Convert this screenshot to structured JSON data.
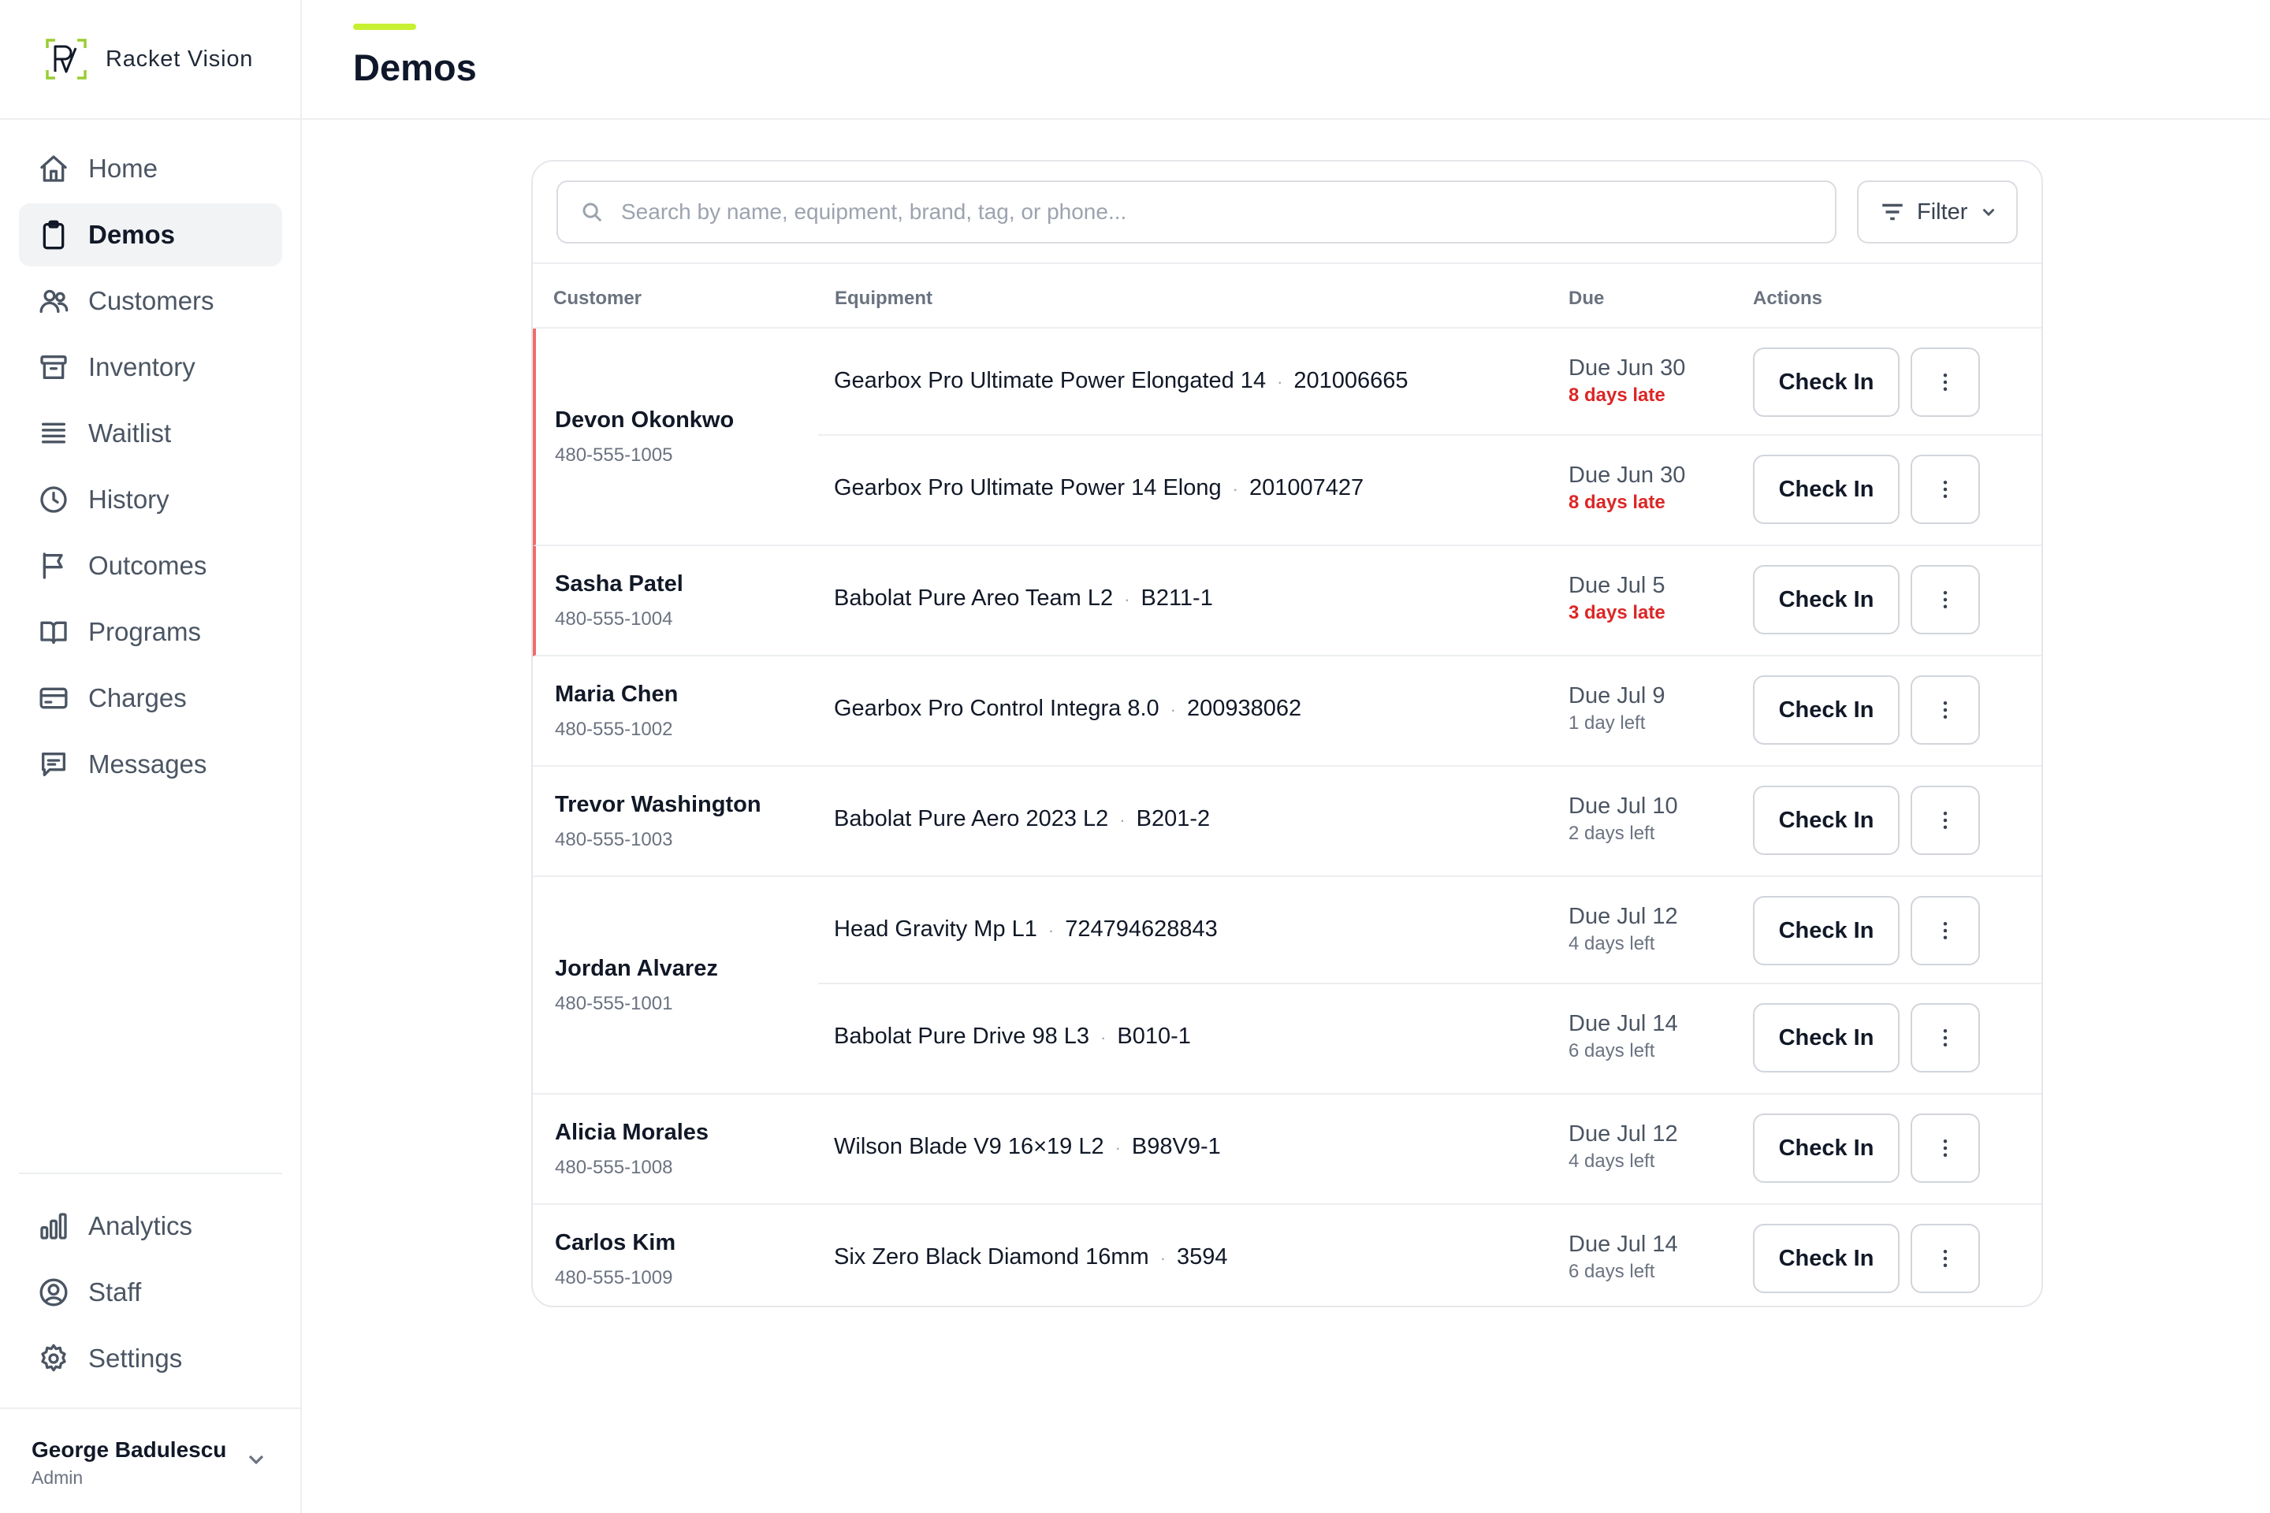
{
  "app": {
    "name": "Racket Vision"
  },
  "sidebar": {
    "items": [
      {
        "label": "Home",
        "icon": "home-icon"
      },
      {
        "label": "Demos",
        "icon": "clipboard-icon",
        "active": true
      },
      {
        "label": "Customers",
        "icon": "users-icon"
      },
      {
        "label": "Inventory",
        "icon": "archive-icon"
      },
      {
        "label": "Waitlist",
        "icon": "list-icon"
      },
      {
        "label": "History",
        "icon": "clock-icon"
      },
      {
        "label": "Outcomes",
        "icon": "flag-icon"
      },
      {
        "label": "Programs",
        "icon": "book-icon"
      },
      {
        "label": "Charges",
        "icon": "credit-card-icon"
      },
      {
        "label": "Messages",
        "icon": "message-icon"
      }
    ],
    "bottom_items": [
      {
        "label": "Analytics",
        "icon": "bar-chart-icon"
      },
      {
        "label": "Staff",
        "icon": "user-circle-icon"
      },
      {
        "label": "Settings",
        "icon": "gear-icon"
      }
    ],
    "user": {
      "name": "George Badulescu",
      "role": "Admin"
    }
  },
  "header": {
    "title": "Demos",
    "accent_color": "#c8f033"
  },
  "toolbar": {
    "search_placeholder": "Search by name, equipment, brand, tag, or phone...",
    "filter_label": "Filter"
  },
  "table": {
    "columns": {
      "customer": "Customer",
      "equipment": "Equipment",
      "due": "Due",
      "actions": "Actions"
    },
    "action_label": "Check In",
    "late_color": "#dc2626",
    "groups": [
      {
        "name": "Devon Okonkwo",
        "phone": "480-555-1005",
        "late": true,
        "items": [
          {
            "equipment": "Gearbox Pro Ultimate Power Elongated 14",
            "tag": "201006665",
            "due": "Due Jun 30",
            "status": "8 days late",
            "late": true
          },
          {
            "equipment": "Gearbox Pro Ultimate Power 14 Elong",
            "tag": "201007427",
            "due": "Due Jun 30",
            "status": "8 days late",
            "late": true
          }
        ]
      },
      {
        "name": "Sasha Patel",
        "phone": "480-555-1004",
        "late": true,
        "items": [
          {
            "equipment": "Babolat Pure Areo Team L2",
            "tag": "B211-1",
            "due": "Due Jul 5",
            "status": "3 days late",
            "late": true
          }
        ]
      },
      {
        "name": "Maria Chen",
        "phone": "480-555-1002",
        "late": false,
        "items": [
          {
            "equipment": "Gearbox Pro Control Integra 8.0",
            "tag": "200938062",
            "due": "Due Jul 9",
            "status": "1 day left",
            "late": false
          }
        ]
      },
      {
        "name": "Trevor Washington",
        "phone": "480-555-1003",
        "late": false,
        "items": [
          {
            "equipment": "Babolat Pure Aero 2023 L2",
            "tag": "B201-2",
            "due": "Due Jul 10",
            "status": "2 days left",
            "late": false
          }
        ]
      },
      {
        "name": "Jordan Alvarez",
        "phone": "480-555-1001",
        "late": false,
        "items": [
          {
            "equipment": "Head Gravity Mp L1",
            "tag": "724794628843",
            "due": "Due Jul 12",
            "status": "4 days left",
            "late": false
          },
          {
            "equipment": "Babolat Pure Drive 98 L3",
            "tag": "B010-1",
            "due": "Due Jul 14",
            "status": "6 days left",
            "late": false
          }
        ]
      },
      {
        "name": "Alicia Morales",
        "phone": "480-555-1008",
        "late": false,
        "items": [
          {
            "equipment": "Wilson Blade V9 16×19 L2",
            "tag": "B98V9-1",
            "due": "Due Jul 12",
            "status": "4 days left",
            "late": false
          }
        ]
      },
      {
        "name": "Carlos Kim",
        "phone": "480-555-1009",
        "late": false,
        "items": [
          {
            "equipment": "Six Zero Black Diamond 16mm",
            "tag": "3594",
            "due": "Due Jul 14",
            "status": "6 days left",
            "late": false
          }
        ]
      }
    ]
  }
}
